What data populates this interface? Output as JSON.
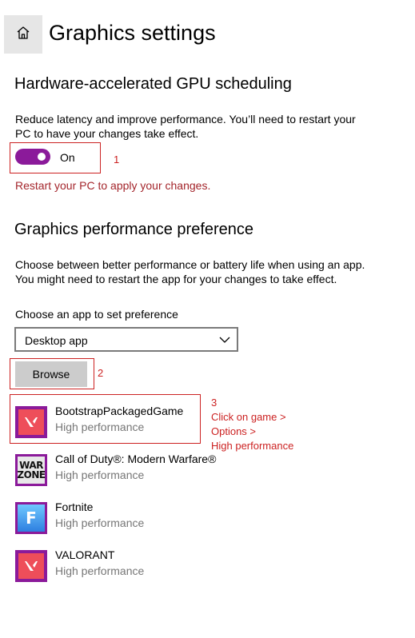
{
  "header": {
    "title": "Graphics settings",
    "home_icon": "home-icon"
  },
  "gpu_scheduling": {
    "title": "Hardware-accelerated GPU scheduling",
    "description_line1": "Reduce latency and improve performance. You’ll need to restart your",
    "description_line2": "PC to have your changes take effect.",
    "toggle_state": "On",
    "toggle_on": true,
    "toggle_color": "#8b1a9a",
    "restart_message": "Restart your PC to apply your changes."
  },
  "perf_pref": {
    "title": "Graphics performance preference",
    "description_line1": "Choose between better performance or battery life when using an app.",
    "description_line2": "You might need to restart the app for your changes to take effect.",
    "choose_label": "Choose an app to set preference",
    "select_value": "Desktop app",
    "browse_label": "Browse"
  },
  "apps": [
    {
      "name": "BootstrapPackagedGame",
      "preference": "High performance",
      "icon": "valorant-icon"
    },
    {
      "name": "Call of Duty®: Modern Warfare®",
      "preference": "High performance",
      "icon": "warzone-icon",
      "icon_text_1": "WAR",
      "icon_text_2": "ZONE"
    },
    {
      "name": "Fortnite",
      "preference": "High performance",
      "icon": "fortnite-icon",
      "icon_text": "F"
    },
    {
      "name": "VALORANT",
      "preference": "High performance",
      "icon": "valorant-icon"
    }
  ],
  "annotations": {
    "step1": "1",
    "step2": "2",
    "step3_line1": "3",
    "step3_line2": "Click on game >",
    "step3_line3": "Options >",
    "step3_line4": "High performance",
    "color": "#cc2222"
  }
}
